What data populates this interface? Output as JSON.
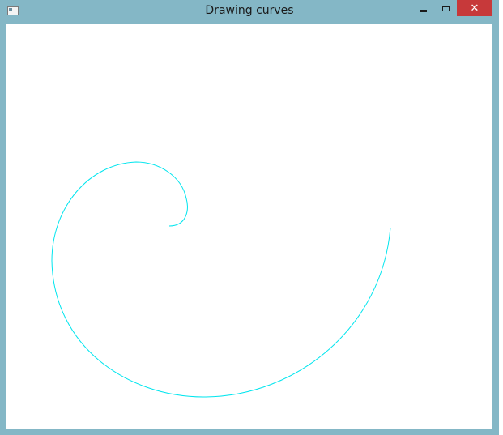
{
  "window": {
    "title": "Drawing curves",
    "system_icon": "window-icon",
    "controls": {
      "minimize_icon": "minimize-icon",
      "maximize_icon": "maximize-icon",
      "close_icon": "close-icon",
      "close_glyph": "✕"
    }
  },
  "canvas": {
    "background": "#ffffff",
    "curve_color": "#00e5ee",
    "curve_type": "spiral"
  },
  "colors": {
    "frame": "#84b7c6",
    "close_button": "#c7393a"
  }
}
